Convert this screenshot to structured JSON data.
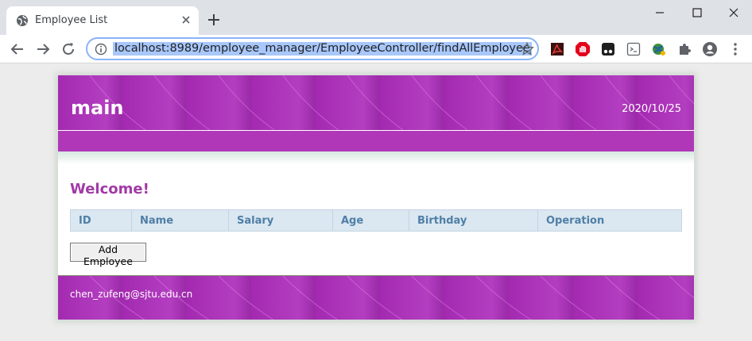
{
  "browser": {
    "tab_title": "Employee List",
    "url": "localhost:8989/employee_manager/EmployeeController/findAllEmployee"
  },
  "icons": {
    "tab": "globe-icon",
    "close": "close-icon",
    "new_tab": "plus-icon",
    "extensions": [
      "pdf-extension-icon",
      "adblock-extension-icon",
      "tampermonkey-extension-icon",
      "mask-extension-icon",
      "network-extension-icon",
      "puzzle-extension-icon",
      "profile-icon",
      "menu-icon"
    ]
  },
  "page": {
    "site_title": "main",
    "date": "2020/10/25",
    "welcome": "Welcome!",
    "table": {
      "headers": [
        "ID",
        "Name",
        "Salary",
        "Age",
        "Birthday",
        "Operation"
      ]
    },
    "add_button": "Add Employee",
    "footer_email": "chen_zufeng@sjtu.edu.cn"
  },
  "colors": {
    "banner": "#a32ab0",
    "navbar": "#b038b8",
    "welcome": "#a13aa6",
    "table_header_bg": "#dbe7f1",
    "table_header_text": "#4f7fa6",
    "url_highlight": "#a8c7fa"
  }
}
